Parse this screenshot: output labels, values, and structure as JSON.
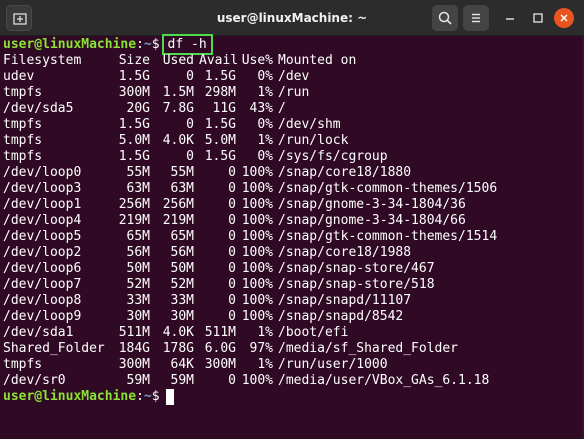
{
  "window": {
    "title": "user@linuxMachine: ~"
  },
  "prompt": {
    "user_host": "user@linuxMachine",
    "path_sep": ":",
    "path": "~",
    "sign": "$"
  },
  "command": "df -h",
  "table": {
    "header": {
      "filesystem": "Filesystem",
      "size": "Size",
      "used": "Used",
      "avail": "Avail",
      "use": "Use%",
      "mounted": "Mounted on"
    },
    "rows": [
      {
        "filesystem": "udev",
        "size": "1.5G",
        "used": "0",
        "avail": "1.5G",
        "use": "0%",
        "mounted": "/dev"
      },
      {
        "filesystem": "tmpfs",
        "size": "300M",
        "used": "1.5M",
        "avail": "298M",
        "use": "1%",
        "mounted": "/run"
      },
      {
        "filesystem": "/dev/sda5",
        "size": "20G",
        "used": "7.8G",
        "avail": "11G",
        "use": "43%",
        "mounted": "/"
      },
      {
        "filesystem": "tmpfs",
        "size": "1.5G",
        "used": "0",
        "avail": "1.5G",
        "use": "0%",
        "mounted": "/dev/shm"
      },
      {
        "filesystem": "tmpfs",
        "size": "5.0M",
        "used": "4.0K",
        "avail": "5.0M",
        "use": "1%",
        "mounted": "/run/lock"
      },
      {
        "filesystem": "tmpfs",
        "size": "1.5G",
        "used": "0",
        "avail": "1.5G",
        "use": "0%",
        "mounted": "/sys/fs/cgroup"
      },
      {
        "filesystem": "/dev/loop0",
        "size": "55M",
        "used": "55M",
        "avail": "0",
        "use": "100%",
        "mounted": "/snap/core18/1880"
      },
      {
        "filesystem": "/dev/loop3",
        "size": "63M",
        "used": "63M",
        "avail": "0",
        "use": "100%",
        "mounted": "/snap/gtk-common-themes/1506"
      },
      {
        "filesystem": "/dev/loop1",
        "size": "256M",
        "used": "256M",
        "avail": "0",
        "use": "100%",
        "mounted": "/snap/gnome-3-34-1804/36"
      },
      {
        "filesystem": "/dev/loop4",
        "size": "219M",
        "used": "219M",
        "avail": "0",
        "use": "100%",
        "mounted": "/snap/gnome-3-34-1804/66"
      },
      {
        "filesystem": "/dev/loop5",
        "size": "65M",
        "used": "65M",
        "avail": "0",
        "use": "100%",
        "mounted": "/snap/gtk-common-themes/1514"
      },
      {
        "filesystem": "/dev/loop2",
        "size": "56M",
        "used": "56M",
        "avail": "0",
        "use": "100%",
        "mounted": "/snap/core18/1988"
      },
      {
        "filesystem": "/dev/loop6",
        "size": "50M",
        "used": "50M",
        "avail": "0",
        "use": "100%",
        "mounted": "/snap/snap-store/467"
      },
      {
        "filesystem": "/dev/loop7",
        "size": "52M",
        "used": "52M",
        "avail": "0",
        "use": "100%",
        "mounted": "/snap/snap-store/518"
      },
      {
        "filesystem": "/dev/loop8",
        "size": "33M",
        "used": "33M",
        "avail": "0",
        "use": "100%",
        "mounted": "/snap/snapd/11107"
      },
      {
        "filesystem": "/dev/loop9",
        "size": "30M",
        "used": "30M",
        "avail": "0",
        "use": "100%",
        "mounted": "/snap/snapd/8542"
      },
      {
        "filesystem": "/dev/sda1",
        "size": "511M",
        "used": "4.0K",
        "avail": "511M",
        "use": "1%",
        "mounted": "/boot/efi"
      },
      {
        "filesystem": "Shared_Folder",
        "size": "184G",
        "used": "178G",
        "avail": "6.0G",
        "use": "97%",
        "mounted": "/media/sf_Shared_Folder"
      },
      {
        "filesystem": "tmpfs",
        "size": "300M",
        "used": "64K",
        "avail": "300M",
        "use": "1%",
        "mounted": "/run/user/1000"
      },
      {
        "filesystem": "/dev/sr0",
        "size": "59M",
        "used": "59M",
        "avail": "0",
        "use": "100%",
        "mounted": "/media/user/VBox_GAs_6.1.18"
      }
    ]
  },
  "colors": {
    "terminal_bg": "#300a24",
    "prompt_user": "#8ae234",
    "prompt_path": "#729fcf",
    "highlight_box": "#4edc4e",
    "close_button": "#e95420"
  },
  "icons": {
    "new_tab": "new-tab-icon",
    "search": "search-icon",
    "menu": "hamburger-menu-icon",
    "minimize": "minimize-icon",
    "maximize": "maximize-icon",
    "close": "close-icon"
  }
}
